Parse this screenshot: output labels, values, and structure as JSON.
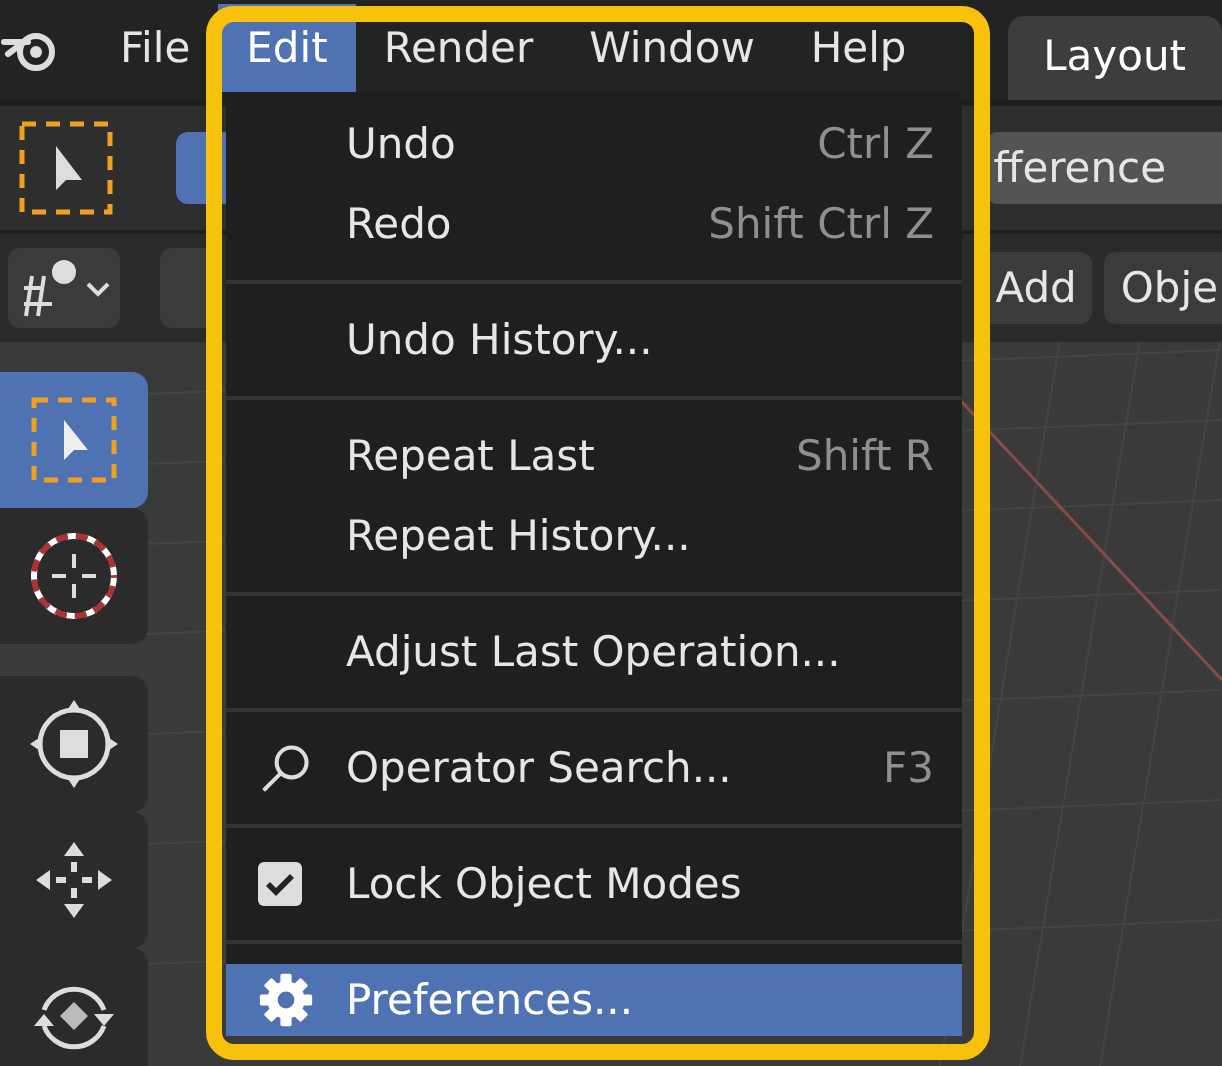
{
  "menubar": {
    "items": [
      {
        "label": "File",
        "selected": false
      },
      {
        "label": "Edit",
        "selected": true
      },
      {
        "label": "Render",
        "selected": false
      },
      {
        "label": "Window",
        "selected": false
      },
      {
        "label": "Help",
        "selected": false
      }
    ]
  },
  "workspace_tab": {
    "label": "Layout"
  },
  "tool_header": {
    "mode_button": "fference"
  },
  "viewport_header": {
    "items": [
      "Add",
      "Obje"
    ]
  },
  "toolbar": {
    "tools": [
      {
        "kind": "select",
        "selected": true
      },
      {
        "kind": "cursor",
        "selected": false
      },
      {
        "kind": "transform",
        "selected": false
      },
      {
        "kind": "move",
        "selected": false
      },
      {
        "kind": "rotate",
        "selected": false
      }
    ]
  },
  "edit_menu": {
    "groups": [
      [
        {
          "kind": "plain",
          "label": "Undo",
          "shortcut": "Ctrl Z",
          "selected": false
        },
        {
          "kind": "plain",
          "label": "Redo",
          "shortcut": "Shift Ctrl Z",
          "selected": false
        }
      ],
      [
        {
          "kind": "plain",
          "label": "Undo History...",
          "selected": false
        }
      ],
      [
        {
          "kind": "plain",
          "label": "Repeat Last",
          "shortcut": "Shift R",
          "selected": false
        },
        {
          "kind": "plain",
          "label": "Repeat History...",
          "selected": false
        }
      ],
      [
        {
          "kind": "plain",
          "label": "Adjust Last Operation...",
          "selected": false
        }
      ],
      [
        {
          "kind": "search",
          "label": "Operator Search...",
          "shortcut": "F3",
          "selected": false
        }
      ],
      [
        {
          "kind": "checkbox",
          "label": "Lock Object Modes",
          "checked": true,
          "selected": false
        }
      ],
      [
        {
          "kind": "settings",
          "label": "Preferences...",
          "selected": true
        }
      ]
    ]
  }
}
